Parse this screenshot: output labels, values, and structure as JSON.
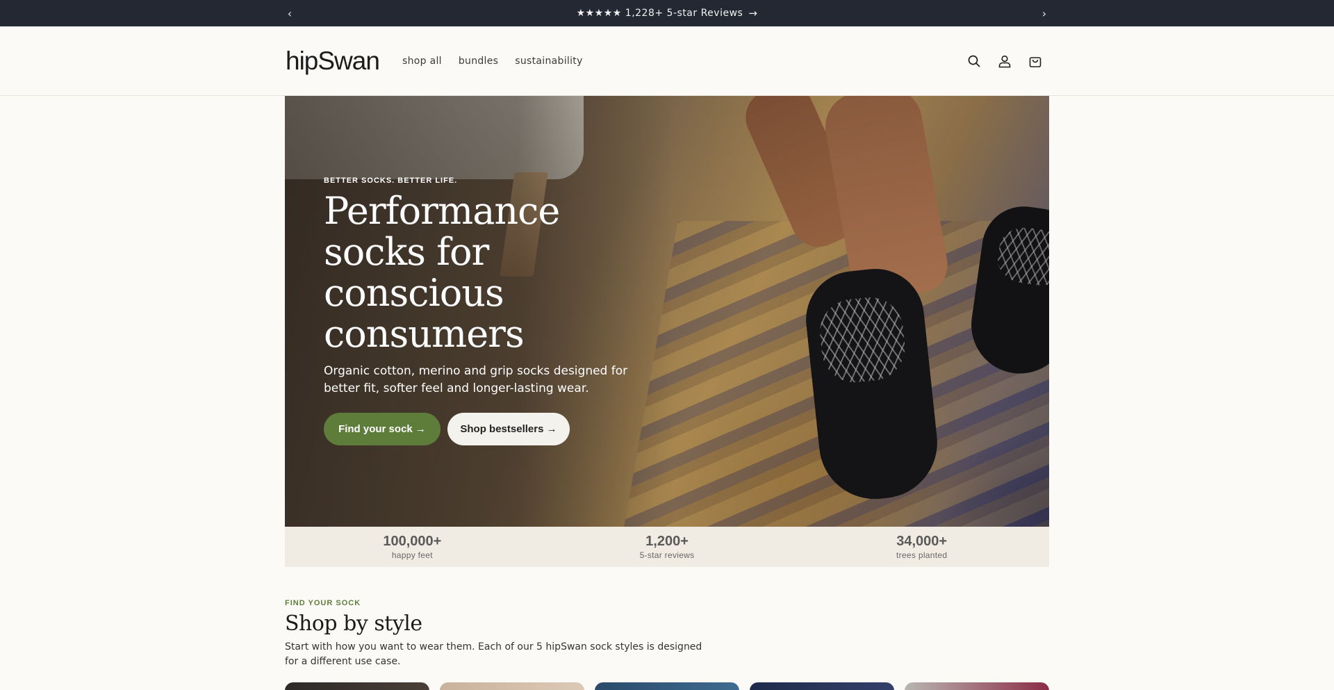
{
  "announcement": {
    "prev_label": "‹",
    "next_label": "›",
    "message": "★★★★★ 1,228+ 5-star Reviews",
    "arrow": "→"
  },
  "header": {
    "logo": "hipSwan",
    "nav": [
      "shop all",
      "bundles",
      "sustainability"
    ],
    "icons": [
      "search-icon",
      "account-icon",
      "cart-icon"
    ]
  },
  "hero": {
    "eyebrow": "BETTER SOCKS. BETTER LIFE.",
    "title": "Performance socks for conscious consumers",
    "subtitle": "Organic cotton, merino and grip socks designed for better fit, softer feel and longer-lasting wear.",
    "primary_cta": "Find your sock →",
    "secondary_cta": "Shop bestsellers →"
  },
  "stats": [
    {
      "value": "100,000+",
      "label": "happy feet"
    },
    {
      "value": "1,200+",
      "label": "5-star reviews"
    },
    {
      "value": "34,000+",
      "label": "trees planted"
    }
  ],
  "shop_by_style": {
    "eyebrow": "FIND YOUR SOCK",
    "title": "Shop by style",
    "description": "Start with how you want to wear them. Each of our 5 hipSwan sock styles is designed for a different use case."
  },
  "colors": {
    "announcement_bg": "#232833",
    "accent_green": "#5e7d3a",
    "page_bg": "#fbfaf6"
  }
}
